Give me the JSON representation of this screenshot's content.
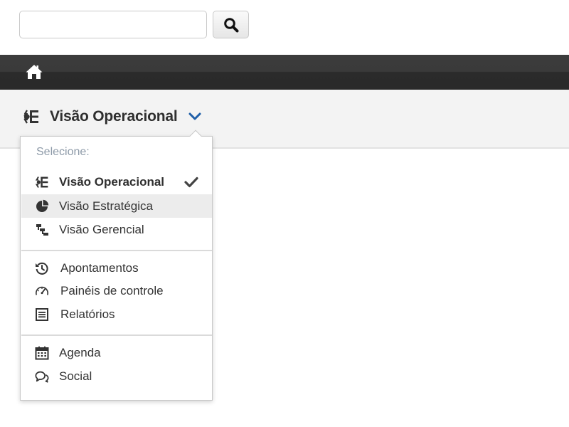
{
  "search": {
    "value": "",
    "placeholder": ""
  },
  "icons": {
    "search": "magnifier-icon",
    "home": "home-icon",
    "operational_view": "operational-view-icon",
    "chevron": "chevron-down-icon",
    "check": "checkmark-icon"
  },
  "colors": {
    "topbar": "#2b2b2b",
    "subbar": "#f3f3f3",
    "accent_chevron": "#1f5fa8",
    "header_text": "#8d9aa8",
    "hover_row": "#ececec"
  },
  "view_selector": {
    "label": "Visão Operacional"
  },
  "dropdown": {
    "header": "Selecione:",
    "groups": [
      [
        {
          "label": "Visão Operacional",
          "icon": "operational-view-icon",
          "selected": true
        },
        {
          "label": "Visão Estratégica",
          "icon": "pie-chart-icon",
          "hovered": true
        },
        {
          "label": "Visão Gerencial",
          "icon": "hierarchy-icon"
        }
      ],
      [
        {
          "label": "Apontamentos",
          "icon": "history-clock-icon"
        },
        {
          "label": "Painéis de controle",
          "icon": "speedometer-icon"
        },
        {
          "label": "Relatórios",
          "icon": "report-list-icon"
        }
      ],
      [
        {
          "label": "Agenda",
          "icon": "calendar-icon"
        },
        {
          "label": "Social",
          "icon": "chat-bubbles-icon"
        }
      ]
    ]
  }
}
